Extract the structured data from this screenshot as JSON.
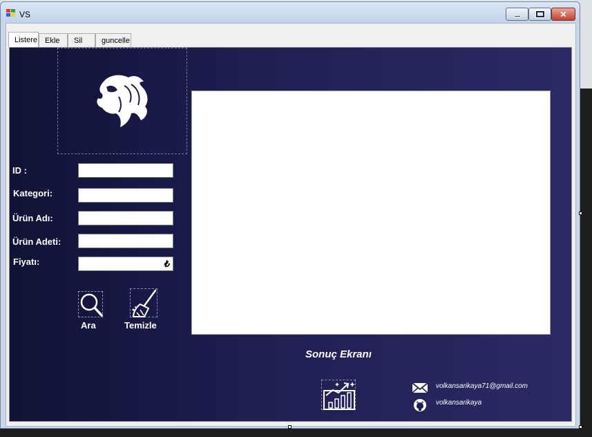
{
  "window": {
    "title": "VS"
  },
  "tabs": [
    "Listere",
    "Ekle",
    "Sil",
    "guncelle"
  ],
  "form": {
    "id_label": "ID :",
    "category_label": "Kategori:",
    "product_name_label": "Ürün Adı:",
    "product_count_label": "Ürün Adeti:",
    "price_label": "Fiyatı:",
    "id_value": "",
    "category_value": "",
    "product_name_value": "",
    "product_count_value": "",
    "price_value": "",
    "currency_symbol": "₺"
  },
  "buttons": {
    "search_label": "Ara",
    "clear_label": "Temizle"
  },
  "result": {
    "caption": "Sonuç Ekranı"
  },
  "contact": {
    "email": "volkansarikaya71@gmail.com",
    "github": "volkansarikaya"
  },
  "colors": {
    "panel_dark": "#101236",
    "panel_light": "#2b2a66",
    "close_red": "#c4402b"
  }
}
